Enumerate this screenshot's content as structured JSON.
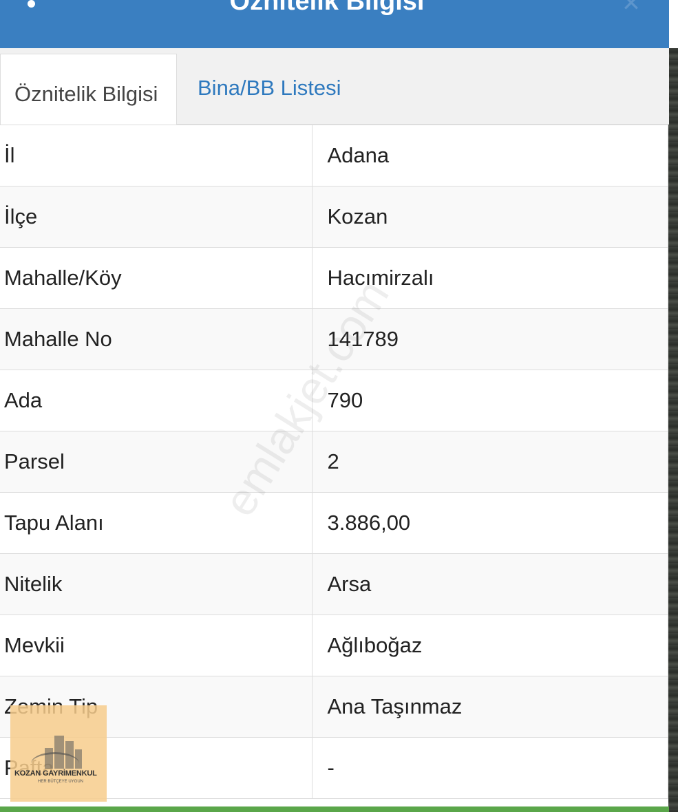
{
  "header": {
    "title": "Öznitelik Bilgisi"
  },
  "tabs": [
    {
      "label": "Öznitelik Bilgisi",
      "active": true
    },
    {
      "label": "Bina/BB Listesi",
      "active": false
    }
  ],
  "rows": [
    {
      "key": "İl",
      "value": "Adana"
    },
    {
      "key": "İlçe",
      "value": "Kozan"
    },
    {
      "key": "Mahalle/Köy",
      "value": "Hacımirzalı"
    },
    {
      "key": "Mahalle No",
      "value": "141789"
    },
    {
      "key": "Ada",
      "value": "790"
    },
    {
      "key": "Parsel",
      "value": "2"
    },
    {
      "key": "Tapu Alanı",
      "value": "3.886,00"
    },
    {
      "key": "Nitelik",
      "value": "Arsa"
    },
    {
      "key": "Mevkii",
      "value": "Ağlıboğaz"
    },
    {
      "key": "Zemin Tip",
      "value": "Ana Taşınmaz"
    },
    {
      "key": "Pafta",
      "value": "-"
    }
  ],
  "watermark": "emlakjet.com",
  "logo": {
    "name": "KOZAN GAYRİMENKUL",
    "tagline": "HER BÜTÇEYE UYGUN"
  },
  "icons": {
    "menu": "kebab-menu-icon",
    "close": "close-icon"
  },
  "colors": {
    "header": "#3a7fc1",
    "tab_link": "#2e79be",
    "bottom_bar": "#5aa64a"
  }
}
